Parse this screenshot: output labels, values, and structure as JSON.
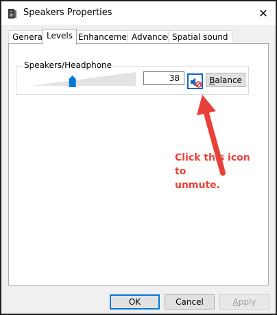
{
  "window": {
    "title": "Speakers Properties",
    "close_glyph": "✕",
    "icon": "speaker-device-icon"
  },
  "tabs": [
    {
      "label": "General",
      "active": false
    },
    {
      "label": "Levels",
      "active": true
    },
    {
      "label": "Enhancements",
      "active": false
    },
    {
      "label": "Advanced",
      "active": false
    },
    {
      "label": "Spatial sound",
      "active": false
    }
  ],
  "levels": {
    "group_label": "Speakers/Headphone",
    "volume_value": "38",
    "volume_fraction": 0.38,
    "muted": true,
    "mute_icon": "speaker-muted-icon",
    "balance_label": "Balance",
    "balance_accesskey": "B"
  },
  "annotation": {
    "text_line1": "Click this icon to",
    "text_line2": "unmute.",
    "color": "#e8413a"
  },
  "footer": {
    "ok_label": "OK",
    "cancel_label": "Cancel",
    "apply_label": "Apply",
    "apply_disabled": true
  },
  "colors": {
    "accent": "#0a64c8",
    "slider_thumb": "#0078d7",
    "annotation": "#e8413a"
  }
}
